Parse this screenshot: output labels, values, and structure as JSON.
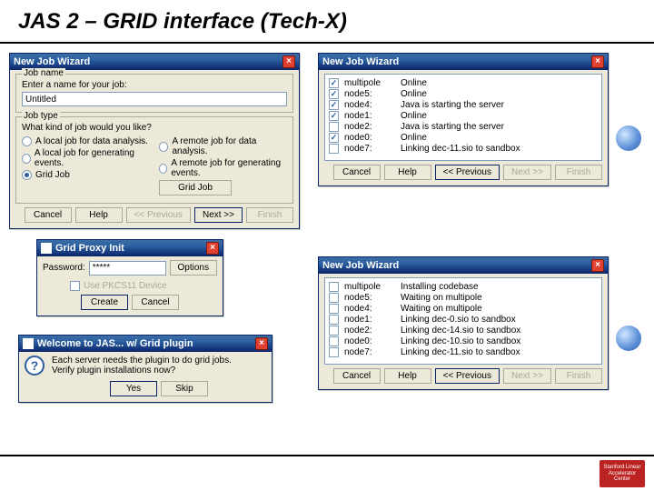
{
  "slide": {
    "title": "JAS 2 – GRID interface (Tech-X)",
    "logo_text": "Stanford Linear Accelerator Center"
  },
  "win_jobwizard1": {
    "title": "New Job Wizard",
    "jobname_legend": "Job name",
    "jobname_prompt": "Enter a name for your job:",
    "jobname_value": "Untitled",
    "jobtype_legend": "Job type",
    "jobtype_prompt": "What kind of job would you like?",
    "opt_local_analysis": "A local job for data analysis.",
    "opt_remote_analysis": "A remote job for data analysis.",
    "opt_local_generate": "A local job for generating events.",
    "opt_remote_generate": "A remote job for generating events.",
    "opt_grid_job": "Grid Job",
    "grid_btn": "Grid Job",
    "btn_cancel": "Cancel",
    "btn_help": "Help",
    "btn_prev": "<< Previous",
    "btn_next": "Next >>",
    "btn_finish": "Finish"
  },
  "win_proxy": {
    "title": "Grid Proxy Init",
    "pw_label": "Password:",
    "pw_value": "*****",
    "options_btn": "Options",
    "use_device": "Use PKCS11 Device",
    "create_btn": "Create",
    "cancel_btn": "Cancel"
  },
  "win_welcome": {
    "title": "Welcome to JAS...   w/ Grid plugin",
    "line1": "Each server needs the plugin to do grid jobs.",
    "line2": "Verify plugin installations now?",
    "yes_btn": "Yes",
    "skip_btn": "Skip"
  },
  "win_nodes1": {
    "title": "New Job Wizard",
    "rows": [
      {
        "chk": true,
        "name": "multipole",
        "status": "Online"
      },
      {
        "chk": true,
        "name": "node5:",
        "status": "Online"
      },
      {
        "chk": true,
        "name": "node4:",
        "status": "Java is starting the server"
      },
      {
        "chk": true,
        "name": "node1:",
        "status": "Online"
      },
      {
        "chk": false,
        "name": "node2:",
        "status": "Java is starting the server"
      },
      {
        "chk": true,
        "name": "node0:",
        "status": "Online"
      },
      {
        "chk": false,
        "name": "node7:",
        "status": "Linking dec-11.sio to sandbox"
      }
    ],
    "btn_cancel": "Cancel",
    "btn_help": "Help",
    "btn_prev": "<< Previous",
    "btn_next": "Next >>",
    "btn_finish": "Finish"
  },
  "win_nodes2": {
    "title": "New Job Wizard",
    "rows": [
      {
        "chk": false,
        "name": "multipole",
        "status": "Installing codebase"
      },
      {
        "chk": false,
        "name": "node5:",
        "status": "Waiting on multipole"
      },
      {
        "chk": false,
        "name": "node4:",
        "status": "Waiting on multipole"
      },
      {
        "chk": false,
        "name": "node1:",
        "status": "Linking dec-0.sio to sandbox"
      },
      {
        "chk": false,
        "name": "node2:",
        "status": "Linking dec-14.sio to sandbox"
      },
      {
        "chk": false,
        "name": "node0:",
        "status": "Linking dec-10.sio to sandbox"
      },
      {
        "chk": false,
        "name": "node7:",
        "status": "Linking dec-11.sio to sandbox"
      }
    ],
    "btn_cancel": "Cancel",
    "btn_help": "Help",
    "btn_prev": "<< Previous",
    "btn_next": "Next >>",
    "btn_finish": "Finish"
  }
}
